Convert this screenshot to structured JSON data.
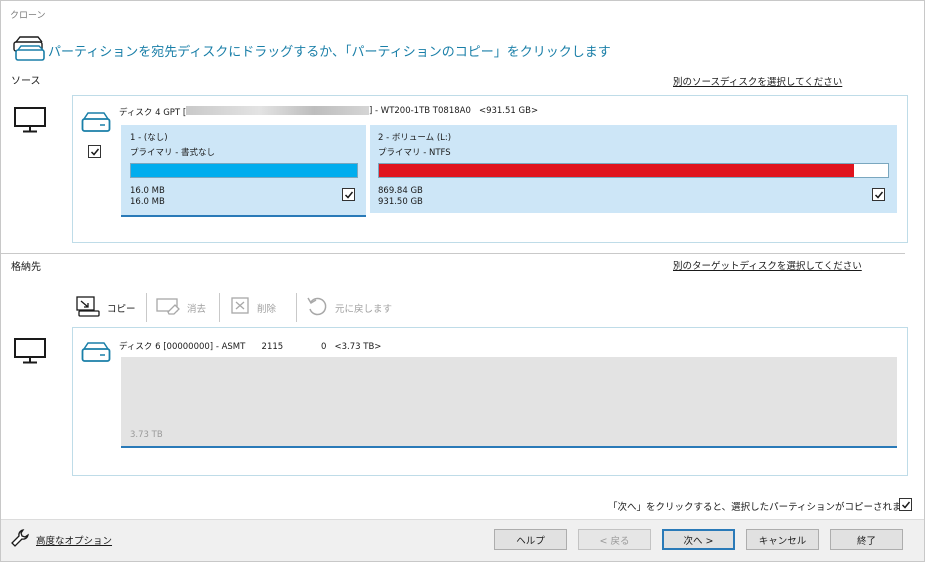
{
  "window": {
    "title": "クローン"
  },
  "header": {
    "instruction": "パーティションを宛先ディスクにドラッグするか、「パーティションのコピー」をクリックします"
  },
  "source": {
    "label": "ソース",
    "select_link": "別のソースディスクを選択してください",
    "disk": {
      "name_prefix": "ディスク 4 GPT [",
      "name_suffix": "] - WT200-1TB T0818A0   <931.51 GB>",
      "partitions": [
        {
          "name": "1 -  (なし)",
          "type": "プライマリ - 書式なし",
          "used": "16.0 MB",
          "total": "16.0 MB",
          "fill_fraction": 1.0,
          "color": "#00adee",
          "checked": true
        },
        {
          "name": "2 - ボリューム (L:)",
          "type": "プライマリ - NTFS",
          "used": "869.84 GB",
          "total": "931.50 GB",
          "fill_fraction": 0.934,
          "color": "#e0141e",
          "checked": true
        }
      ]
    }
  },
  "destination": {
    "label": "格納先",
    "select_link": "別のターゲットディスクを選択してください",
    "toolbar": {
      "copy": "コピー",
      "erase": "消去",
      "delete": "削除",
      "undo": "元に戻します"
    },
    "disk": {
      "name": "ディスク 6 [00000000] - ASMT      2115              0   <3.73 TB>",
      "unallocated_size": "3.73 TB"
    }
  },
  "notice": {
    "text": "「次へ」をクリックすると、選択したパーティションがコピーされます",
    "checked": true
  },
  "footer": {
    "advanced_options": "高度なオプション",
    "help": "ヘルプ",
    "back": "< 戻る",
    "next": "次へ >",
    "cancel": "キャンセル",
    "finish": "終了"
  }
}
